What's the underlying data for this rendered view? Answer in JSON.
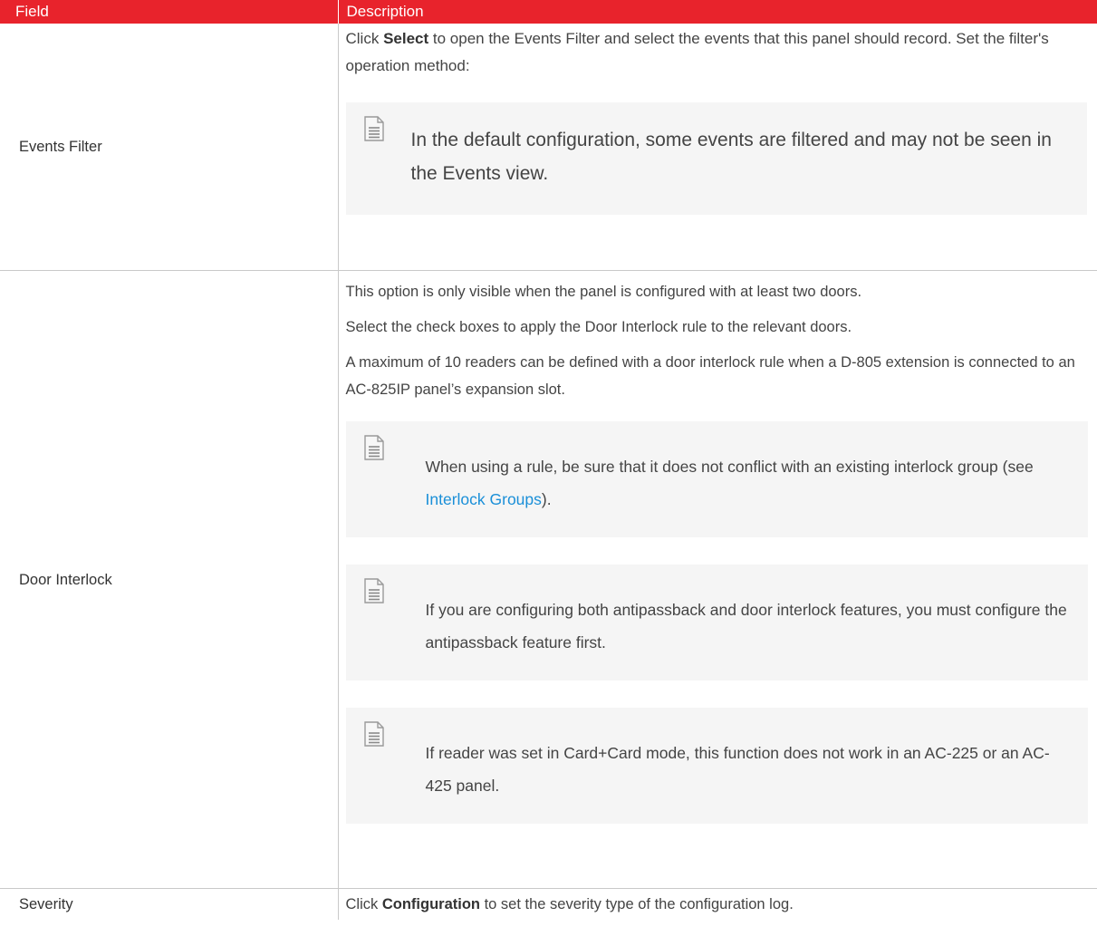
{
  "header": {
    "field": "Field",
    "description": "Description"
  },
  "rows": [
    {
      "field": "Events Filter",
      "desc": {
        "p1_pre": "Click ",
        "p1_bold": "Select",
        "p1_post": " to open the Events Filter and select the events that this panel should record. Set the filter's operation method:",
        "note": "In the default configuration, some events are filtered and may not be seen in the Events view."
      }
    },
    {
      "field": "Door Interlock",
      "desc": {
        "p1": "This option is only visible when the panel is configured with at least two doors.",
        "p2": "Select the check boxes to apply the Door Interlock rule to the relevant doors.",
        "p3": "A maximum of 10 readers can be defined with a door interlock rule when a D-805 extension is connected to an AC-825IP panel’s expansion slot.",
        "note1_pre": "When using a rule, be sure that it does not conflict with an existing interlock group (see ",
        "note1_link": "Interlock Groups",
        "note1_post": ").",
        "note2": "If you are configuring both antipassback and door interlock features, you must configure the antipassback feature first.",
        "note3": "If reader was set in Card+Card mode, this function does not work in an AC-225 or an AC-425 panel."
      }
    },
    {
      "field": "Severity",
      "desc": {
        "p1_pre": "Click ",
        "p1_bold": "Configuration",
        "p1_post": " to set the severity type of the configuration log."
      }
    }
  ],
  "icons": {
    "note": "note-document-icon"
  },
  "colors": {
    "header_bg": "#e8232c",
    "link": "#1a8fd8",
    "note_bg": "#f5f5f5"
  }
}
